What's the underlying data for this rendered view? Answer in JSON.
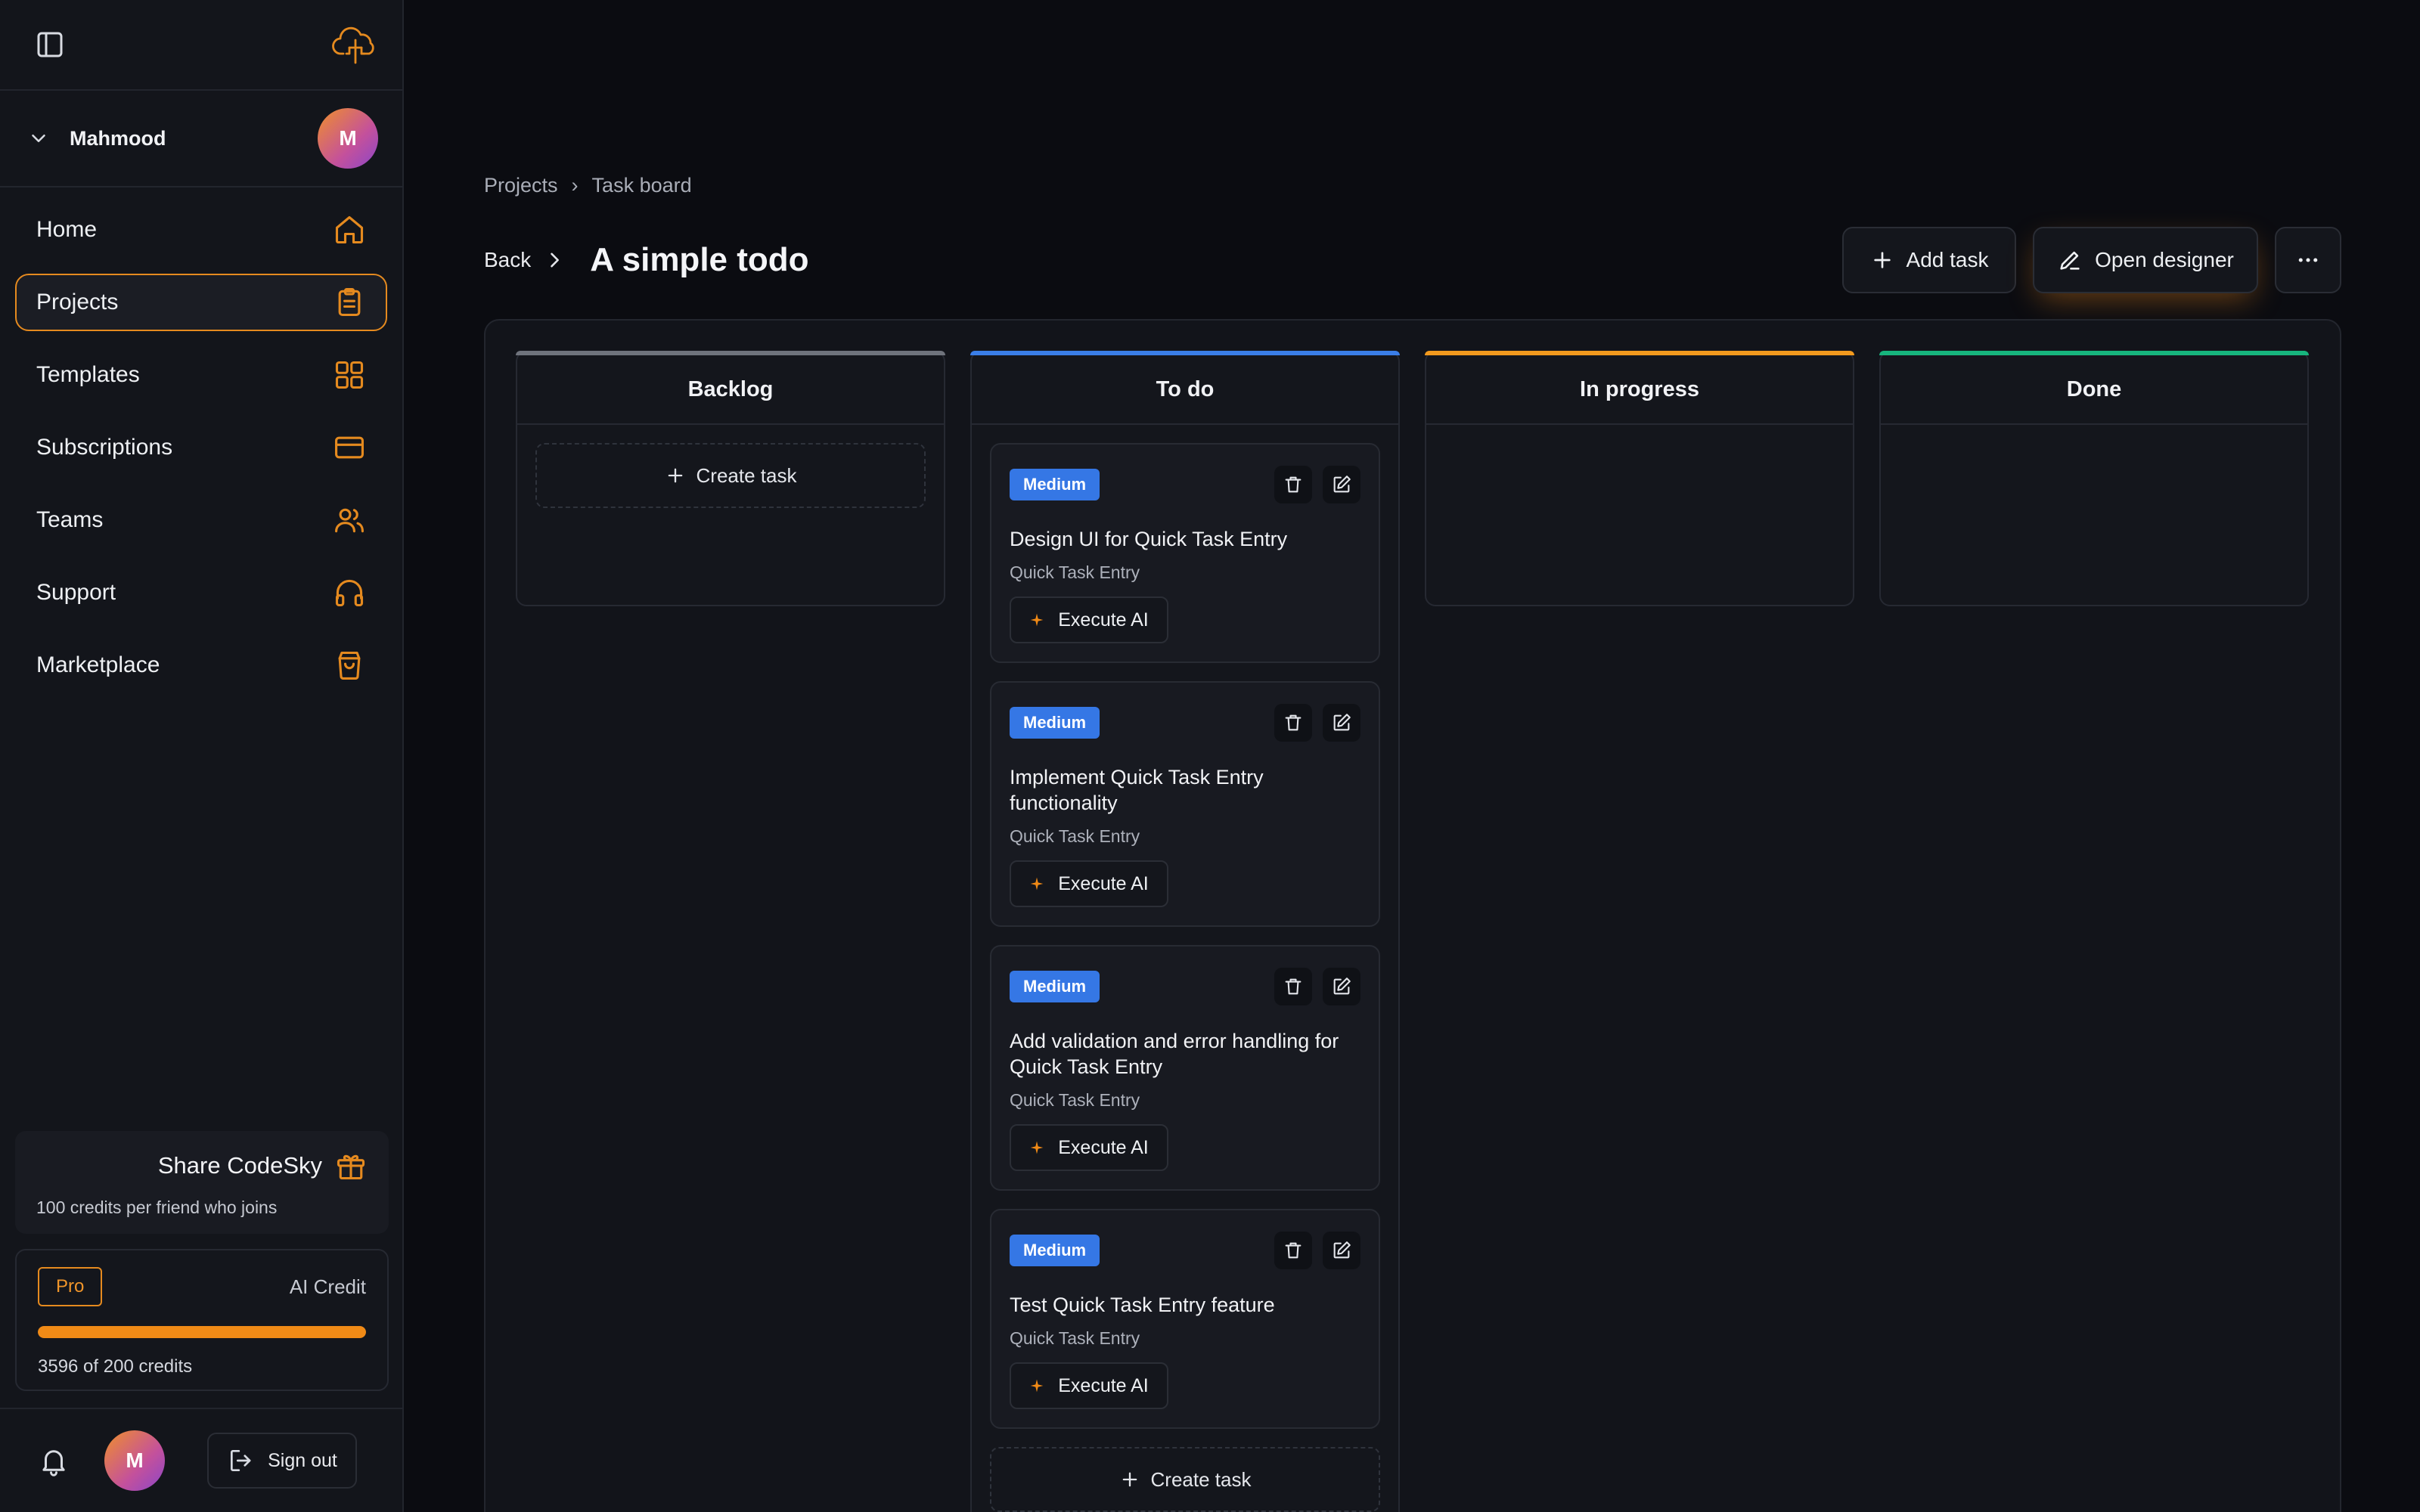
{
  "sidebar": {
    "user": {
      "name": "Mahmood",
      "initial": "M"
    },
    "items": [
      {
        "label": "Home",
        "icon": "home-icon",
        "active": false
      },
      {
        "label": "Projects",
        "icon": "clipboard-icon",
        "active": true
      },
      {
        "label": "Templates",
        "icon": "grid-icon",
        "active": false
      },
      {
        "label": "Subscriptions",
        "icon": "credit-card-icon",
        "active": false
      },
      {
        "label": "Teams",
        "icon": "users-icon",
        "active": false
      },
      {
        "label": "Support",
        "icon": "headphones-icon",
        "active": false
      },
      {
        "label": "Marketplace",
        "icon": "shopping-bag-icon",
        "active": false
      }
    ],
    "share": {
      "title": "Share CodeSky",
      "subtitle": "100 credits per friend who joins"
    },
    "credit": {
      "plan": "Pro",
      "label": "AI Credit",
      "count_text": "3596 of 200 credits",
      "progress": 1.0
    },
    "bottom": {
      "initial": "M",
      "signout_label": "Sign out"
    }
  },
  "breadcrumb": {
    "items": [
      "Projects",
      "Task board"
    ],
    "separator": "›"
  },
  "header": {
    "back_label": "Back",
    "title": "A simple todo",
    "add_task_label": "Add task",
    "open_designer_label": "Open designer"
  },
  "colors": {
    "accent": "#e58a1f",
    "backlog": "#6f737c",
    "todo": "#3a7ee8",
    "in_progress": "#f29a1e",
    "done": "#17b57d",
    "badge": "#3577e5"
  },
  "board": {
    "create_task_label": "Create task",
    "columns": [
      {
        "title": "Backlog"
      },
      {
        "title": "To do"
      },
      {
        "title": "In progress"
      },
      {
        "title": "Done"
      }
    ],
    "tasks": [
      {
        "priority": "Medium",
        "title": "Design UI for Quick Task Entry",
        "feature": "Quick Task Entry",
        "action": "Execute AI"
      },
      {
        "priority": "Medium",
        "title": "Implement Quick Task Entry functionality",
        "feature": "Quick Task Entry",
        "action": "Execute AI"
      },
      {
        "priority": "Medium",
        "title": "Add validation and error handling for Quick Task Entry",
        "feature": "Quick Task Entry",
        "action": "Execute AI"
      },
      {
        "priority": "Medium",
        "title": "Test Quick Task Entry feature",
        "feature": "Quick Task Entry",
        "action": "Execute AI"
      }
    ]
  }
}
